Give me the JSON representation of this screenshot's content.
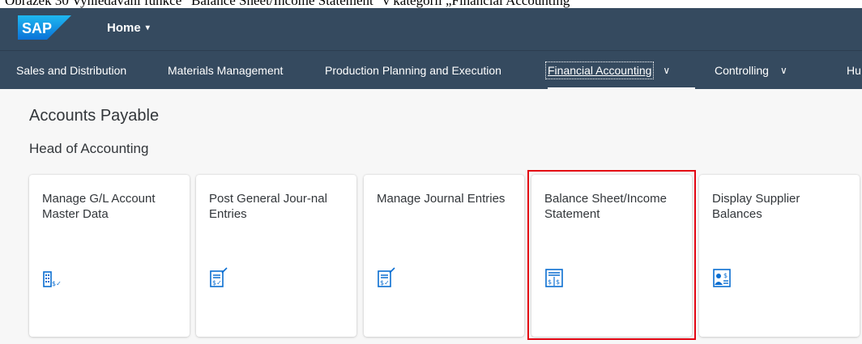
{
  "caption": "Obrázek 30 Vyhledávání funkce “Balance Sheet/Income Statement” v kategorii „Financial Accounting“",
  "shell": {
    "logo_text": "SAP",
    "home_label": "Home",
    "home_caret": "▾"
  },
  "nav": {
    "tabs": [
      {
        "label": "Sales and Distribution"
      },
      {
        "label": "Materials Management"
      },
      {
        "label": "Production Planning and Execution"
      },
      {
        "label": "Financial Accounting",
        "chevron": "∨"
      },
      {
        "label": "Controlling",
        "chevron": "∨"
      },
      {
        "label": "Hu"
      }
    ]
  },
  "page": {
    "section_title": "Accounts Payable",
    "group_title": "Head of Accounting"
  },
  "tiles": [
    {
      "title": "Manage G/L Account Master Data",
      "icon": "building-money-icon"
    },
    {
      "title": "Post General Jour-nal Entries",
      "icon": "document-money-icon"
    },
    {
      "title": "Manage Journal Entries",
      "icon": "document-money-icon"
    },
    {
      "title": "Balance Sheet/Income Statement",
      "icon": "balance-sheet-icon"
    },
    {
      "title": "Display Supplier Balances",
      "icon": "supplier-money-icon"
    }
  ],
  "colors": {
    "shell_bg": "#354a5f",
    "highlight": "#e30613",
    "icon": "#0a6ed1"
  }
}
